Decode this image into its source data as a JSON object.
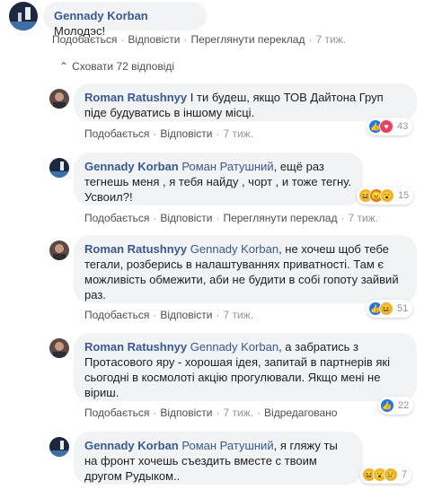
{
  "top_comment": {
    "author": "Gennady Korban",
    "text": "Молодэс!",
    "actions": {
      "like": "Подобається",
      "reply": "Відповісти",
      "translate": "Переглянути переклад",
      "time": "7 тиж."
    }
  },
  "collapse": {
    "arrow": "⌃",
    "label": "Сховати 72 відповіді"
  },
  "replies": [
    {
      "author": "Roman Ratushnyy",
      "mention": "",
      "text": "І ти будеш, якщо ТОВ Дайтона Груп піде будуватись в іншому місці.",
      "actions": {
        "like": "Подобається",
        "reply": "Відповісти",
        "time": "7 тиж."
      },
      "reactions": {
        "icons": [
          "like",
          "love"
        ],
        "count": "43"
      }
    },
    {
      "author": "Gennady Korban",
      "mention": "Роман Ратушний",
      "text": ", ещё раз тегнешь меня , я тебя найду , чорт , и тоже тегну. Усвоил?!",
      "actions": {
        "like": "Подобається",
        "reply": "Відповісти",
        "translate": "Переглянути переклад",
        "time": "7 тиж."
      },
      "reactions": {
        "icons": [
          "haha",
          "angry",
          "wow"
        ],
        "count": "15"
      }
    },
    {
      "author": "Roman Ratushnyy",
      "mention": "Gennady Korban",
      "text": ", не хочеш щоб тебе тегали, розберись в налаштуваннях приватності. Там є можливість обмежити, аби не будити в собі гопоту зайвий раз.",
      "actions": {
        "like": "Подобається",
        "reply": "Відповісти",
        "time": "7 тиж."
      },
      "reactions": {
        "icons": [
          "like",
          "haha"
        ],
        "count": "51"
      }
    },
    {
      "author": "Roman Ratushnyy",
      "mention": "Gennady Korban",
      "text": ", а забратись з Протасового яру - хорошая ідея, запитай в партнерів які сьогодні в космолоті акцію прогулювали. Якщо мені не віриш.",
      "actions": {
        "like": "Подобається",
        "reply": "Відповісти",
        "time": "7 тиж.",
        "edited": "Відредаговано"
      },
      "reactions": {
        "icons": [
          "like"
        ],
        "count": "22"
      }
    },
    {
      "author": "Gennady Korban",
      "mention": "Роман Ратушний",
      "text": ", я гляжу ты на фронт хочешь съездить вместе с твоим другом Рудыком..",
      "actions": {},
      "reactions": {
        "icons": [
          "haha",
          "wow",
          "sad"
        ],
        "count": "7"
      }
    }
  ],
  "colors": {
    "link": "#385898",
    "bubble": "#f2f3f5",
    "meta": "#90949c",
    "like": "#1877f2",
    "love": "#f33e58"
  },
  "reaction_glyphs": {
    "like": "👍",
    "love": "♥",
    "haha": "😆",
    "wow": "😮",
    "sad": "😢",
    "angry": "😠"
  }
}
